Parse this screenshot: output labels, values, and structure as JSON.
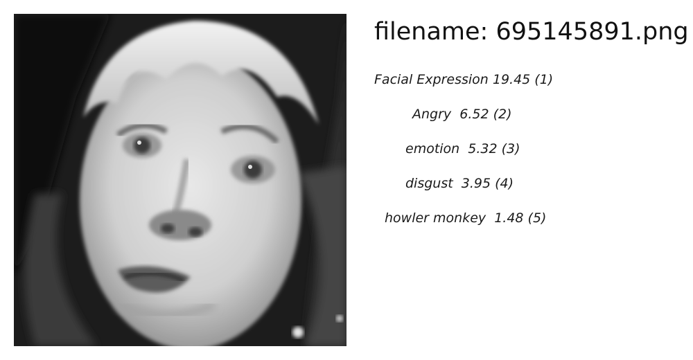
{
  "header": {
    "filename_text": "filename: 695145891.png"
  },
  "photo": {
    "subject": "black-and-white close-up photograph of a young child's face"
  },
  "predictions": [
    {
      "text": "Facial Expression 19.45 (1)",
      "label": "Facial Expression",
      "score": 19.45,
      "rank": 1
    },
    {
      "text": "Angry  6.52 (2)",
      "label": "Angry",
      "score": 6.52,
      "rank": 2
    },
    {
      "text": "emotion  5.32 (3)",
      "label": "emotion",
      "score": 5.32,
      "rank": 3
    },
    {
      "text": "disgust  3.95 (4)",
      "label": "disgust",
      "score": 3.95,
      "rank": 4
    },
    {
      "text": "howler monkey  1.48 (5)",
      "label": "howler monkey",
      "score": 1.48,
      "rank": 5
    }
  ]
}
